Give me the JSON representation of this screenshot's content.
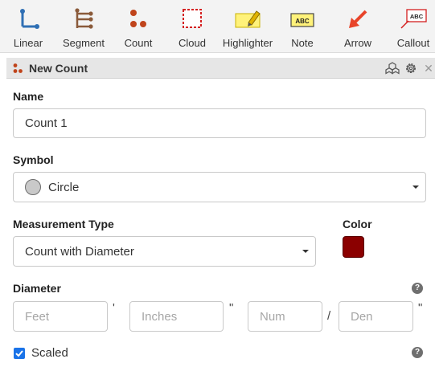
{
  "toolbar": {
    "tools": [
      {
        "label": "Linear",
        "icon": "linear-measure-icon"
      },
      {
        "label": "Segment",
        "icon": "segment-measure-icon"
      },
      {
        "label": "Count",
        "icon": "count-icon"
      },
      {
        "label": "Cloud",
        "icon": "cloud-icon"
      },
      {
        "label": "Highlighter",
        "icon": "highlighter-icon"
      },
      {
        "label": "Note",
        "icon": "note-icon",
        "icon_text": "ABC"
      },
      {
        "label": "Arrow",
        "icon": "arrow-icon"
      },
      {
        "label": "Callout",
        "icon": "callout-icon",
        "icon_text": "ABC"
      }
    ]
  },
  "panel": {
    "title": "New Count",
    "header_icons": [
      "group-icon",
      "gear-icon",
      "close-icon"
    ],
    "close_glyph": "✕"
  },
  "form": {
    "name_label": "Name",
    "name_value": "Count 1",
    "symbol_label": "Symbol",
    "symbol_value": "Circle",
    "measurement_type_label": "Measurement Type",
    "measurement_type_value": "Count with Diameter",
    "color_label": "Color",
    "color_value": "#8b0000",
    "diameter_label": "Diameter",
    "help_glyph": "?",
    "feet_placeholder": "Feet",
    "feet_mark": "'",
    "inches_placeholder": "Inches",
    "inches_mark": "\"",
    "num_placeholder": "Num",
    "fraction_mark": "/",
    "den_placeholder": "Den",
    "den_mark": "\"",
    "scaled_label": "Scaled",
    "scaled_checked": true
  },
  "colors": {
    "accent_blue": "#2f6fb4",
    "count_orange": "#c0441b",
    "cloud_red": "#d42020",
    "highlighter_yellow": "#fff27a",
    "arrow_red": "#e8442a",
    "checkbox_blue": "#1a73e8"
  }
}
